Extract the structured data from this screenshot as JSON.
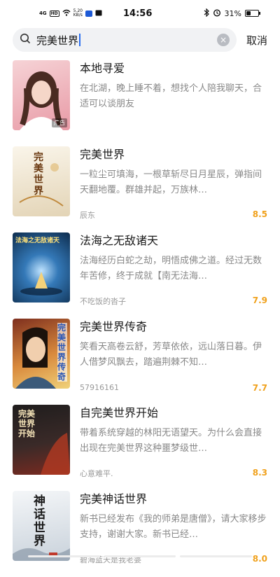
{
  "status_bar": {
    "network": "4G",
    "hd_badge": "HD",
    "speed_value": "5.20",
    "speed_unit": "KB/s",
    "time": "14:56",
    "battery": "31%",
    "battery_level": 0.31,
    "icons": [
      "signal-icon",
      "wifi-icon",
      "message-icon",
      "bluetooth-icon",
      "alarm-icon",
      "battery-icon"
    ]
  },
  "search": {
    "query": "完美世界",
    "cancel_label": "取消",
    "clear_icon": "×"
  },
  "results": [
    {
      "title": "本地寻爱",
      "desc": "在北湖，晚上睡不着，想找个人陪我聊天，合适可以谈朋友",
      "author": "",
      "score": "",
      "cover_badge": "广告",
      "colors": [
        "#f3c9cf",
        "#e88f9c"
      ]
    },
    {
      "title": "完美世界",
      "desc": "一粒尘可填海，一根草斩尽日月星辰，弹指间天翻地覆。群雄并起，万族林…",
      "author": "辰东",
      "score": "8.5",
      "cover_text": "完美世界",
      "colors": [
        "#f7f0e2",
        "#d9c8a7"
      ]
    },
    {
      "title": "法海之无敌诸天",
      "desc": "法海经历白蛇之劫，明悟成佛之道。经过无数年苦修，终于成就【南无法海…",
      "author": "不吃饭的沓子",
      "score": "7.9",
      "cover_text": "法海之无敌诸天",
      "colors": [
        "#0e3b66",
        "#2f80c2"
      ]
    },
    {
      "title": "完美世界传奇",
      "desc": "笑看天高卷云舒，芳草依依，远山落日暮。伊人借梦风飘去，踏遍荆棘不知…",
      "author": "57916161",
      "score": "7.7",
      "cover_text": "完美世界传奇",
      "colors": [
        "#a9472a",
        "#e9c26b"
      ]
    },
    {
      "title": "自完美世界开始",
      "desc": "带着系统穿越的林阳无语望天。为什么会直接出现在完美世界这种噩梦级世…",
      "author": "心意难平.",
      "score": "8.3",
      "cover_text": "完美世界开始",
      "colors": [
        "#2c2a2a",
        "#7a2a22"
      ]
    },
    {
      "title": "完美神话世界",
      "desc": "新书已经发布《我的师弟是唐僧》，请大家移步支持，谢谢大家。新书已经…",
      "author": "碧海蓝天是我老婆",
      "score": "8.0",
      "cover_text": "神话世界",
      "colors": [
        "#eef1f4",
        "#aab6c2"
      ]
    }
  ]
}
